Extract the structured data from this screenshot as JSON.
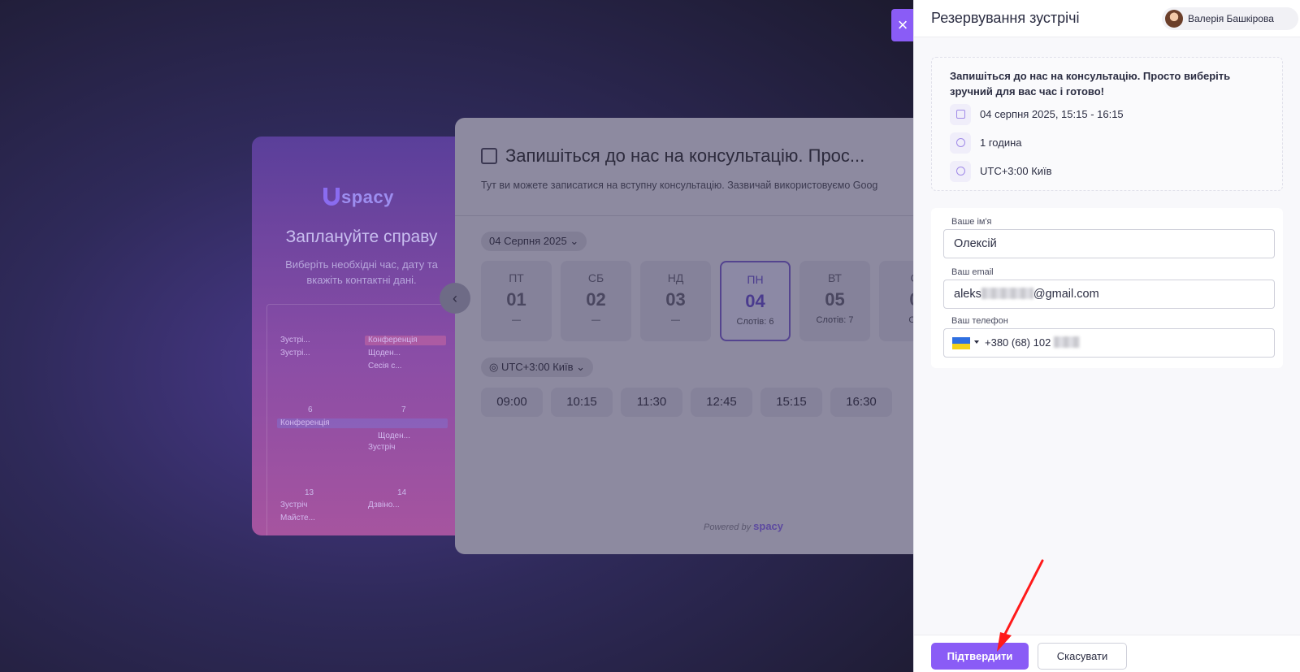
{
  "background": {
    "promo": {
      "logo": "spacy",
      "title": "Заплануйте справу",
      "subtitle": "Виберіть необхідні час, дату та вкажіть контактні дані.",
      "calendar": {
        "day_numbers": [
          "6",
          "7",
          "13",
          "14"
        ],
        "events": [
          "Зустрі...",
          "Зустрі...",
          "Конференція",
          "Щоден...",
          "Сесія с...",
          "Конференція",
          "Щоден...",
          "Зустріч",
          "Зустріч",
          "Майсте...",
          "Дзвіно..."
        ]
      }
    },
    "booking_card": {
      "title": "Запишіться до нас на консультацію. Прос...",
      "description": "Тут ви можете записатися на вступну консультацію. Зазвичай використовуємо Goog",
      "date_selector": "04 Серпня 2025",
      "days": [
        {
          "name": "ПТ",
          "date": "01",
          "slots": "—"
        },
        {
          "name": "СБ",
          "date": "02",
          "slots": "—"
        },
        {
          "name": "НД",
          "date": "03",
          "slots": "—"
        },
        {
          "name": "ПН",
          "date": "04",
          "slots": "Слотів: 6"
        },
        {
          "name": "ВТ",
          "date": "05",
          "slots": "Слотів: 7"
        },
        {
          "name": "С",
          "date": "0",
          "slots": "Сл"
        }
      ],
      "timezone_selector": "UTC+3:00 Київ",
      "time_slots": [
        "09:00",
        "10:15",
        "11:30",
        "12:45",
        "15:15",
        "16:30"
      ],
      "powered_by": "Powered by",
      "powered_logo": "spacy"
    }
  },
  "panel": {
    "title": "Резервування зустрічі",
    "user_name": "Валерія Башкірова",
    "close_icon": "×",
    "intro": "Запишіться до нас на консультацію. Просто виберіть зручний для вас час і готово!",
    "date_time": "04 серпня 2025, 15:15 - 16:15",
    "duration": "1 година",
    "timezone": "UTC+3:00 Київ",
    "form": {
      "name_label": "Ваше ім'я",
      "name_value": "Олексій",
      "email_label": "Ваш email",
      "email_prefix": "aleks",
      "email_suffix": "@gmail.com",
      "phone_label": "Ваш телефон",
      "phone_value": "+380 (68) 102"
    },
    "confirm_label": "Підтвердити",
    "cancel_label": "Скасувати"
  },
  "colors": {
    "accent": "#8a5cf6",
    "annotation_arrow": "#ff1a1a"
  }
}
